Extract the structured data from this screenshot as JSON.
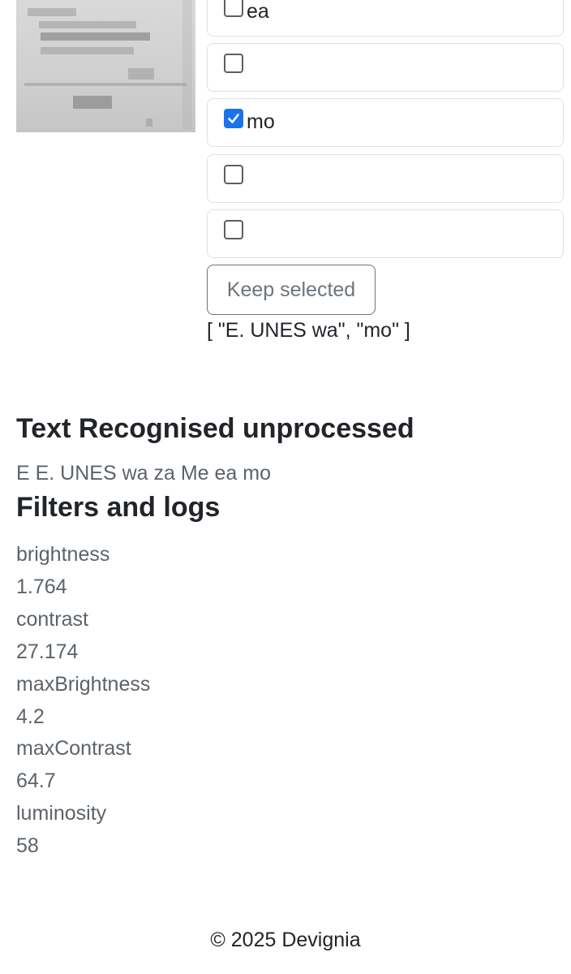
{
  "options": [
    {
      "label": "ea",
      "checked": false
    },
    {
      "label": "",
      "checked": false
    },
    {
      "label": "mo",
      "checked": true
    },
    {
      "label": "",
      "checked": false
    },
    {
      "label": "",
      "checked": false
    }
  ],
  "keep_button_label": "Keep selected",
  "selected_output": "[ \"E. UNES wa\", \"mo\" ]",
  "recognised": {
    "heading": "Text Recognised unprocessed",
    "text": "E E. UNES wa za Me ea mo"
  },
  "filters": {
    "heading": "Filters and logs",
    "brightness_label": "brightness",
    "brightness_value": "1.764",
    "contrast_label": "contrast",
    "contrast_value": "27.174",
    "max_brightness_label": "maxBrightness",
    "max_brightness_value": "4.2",
    "max_contrast_label": "maxContrast",
    "max_contrast_value": "64.7",
    "luminosity_label": "luminosity",
    "luminosity_value": "58"
  },
  "footer": "© 2025 Devignia",
  "colors": {
    "checkbox_checked": "#1a73e8",
    "muted_text": "#5c636a"
  }
}
